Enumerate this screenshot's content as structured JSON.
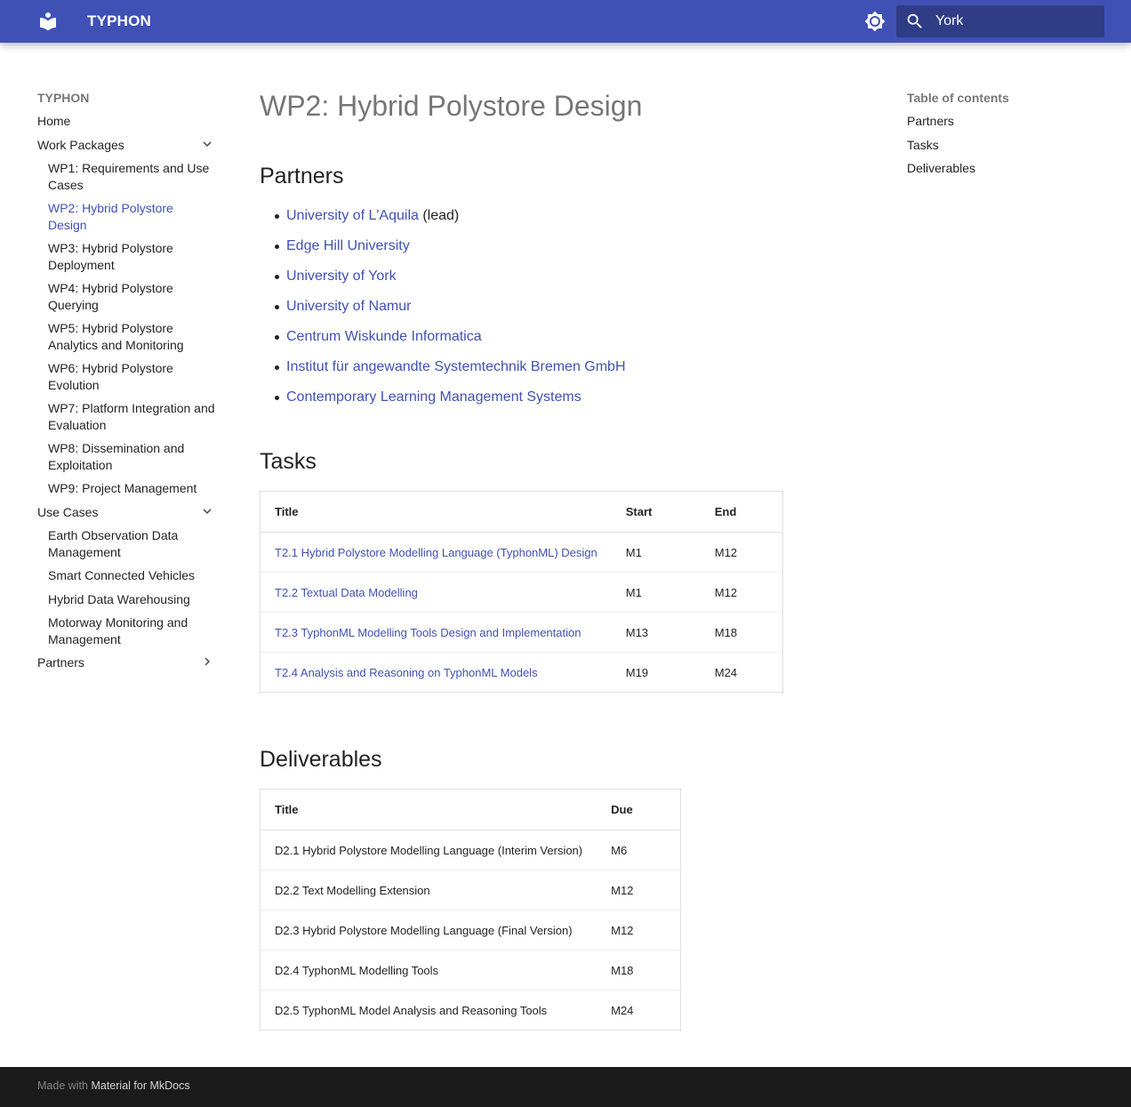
{
  "header": {
    "site_title": "TYPHON",
    "logo_icon": "book-open-icon",
    "palette_icon": "brightness-icon",
    "search": {
      "value": "York",
      "placeholder": "Search"
    },
    "colors": {
      "primary": "#4051b5"
    }
  },
  "sidebar": {
    "title": "TYPHON",
    "home": "Home",
    "work_packages": {
      "label": "Work Packages",
      "items": [
        "WP1: Requirements and Use Cases",
        "WP2: Hybrid Polystore Design",
        "WP3: Hybrid Polystore Deployment",
        "WP4: Hybrid Polystore Querying",
        "WP5: Hybrid Polystore Analytics and Monitoring",
        "WP6: Hybrid Polystore Evolution",
        "WP7: Platform Integration and Evaluation",
        "WP8: Dissemination and Exploitation",
        "WP9: Project Management"
      ]
    },
    "use_cases": {
      "label": "Use Cases",
      "items": [
        "Earth Observation Data Management",
        "Smart Connected Vehicles",
        "Hybrid Data Warehousing",
        "Motorway Monitoring and Management"
      ]
    },
    "partners": "Partners"
  },
  "toc": {
    "title": "Table of contents",
    "items": [
      "Partners",
      "Tasks",
      "Deliverables"
    ]
  },
  "main": {
    "title": "WP2: Hybrid Polystore Design",
    "partners_heading": "Partners",
    "partners": [
      {
        "name": "University of L'Aquila",
        "suffix": " (lead)"
      },
      {
        "name": "Edge Hill University",
        "suffix": ""
      },
      {
        "name": "University of York",
        "suffix": ""
      },
      {
        "name": "University of Namur",
        "suffix": ""
      },
      {
        "name": "Centrum Wiskunde Informatica",
        "suffix": ""
      },
      {
        "name": "Institut für angewandte Systemtechnik Bremen GmbH",
        "suffix": ""
      },
      {
        "name": "Contemporary Learning Management Systems",
        "suffix": ""
      }
    ],
    "tasks_heading": "Tasks",
    "tasks_table": {
      "headers": [
        "Title",
        "Start",
        "End"
      ],
      "rows": [
        [
          "T2.1 Hybrid Polystore Modelling Language (TyphonML) Design",
          "M1",
          "M12"
        ],
        [
          "T2.2 Textual Data Modelling",
          "M1",
          "M12"
        ],
        [
          "T2.3 TyphonML Modelling Tools Design and Implementation",
          "M13",
          "M18"
        ],
        [
          "T2.4 Analysis and Reasoning on TyphonML Models",
          "M19",
          "M24"
        ]
      ]
    },
    "deliverables_heading": "Deliverables",
    "deliverables_table": {
      "headers": [
        "Title",
        "Due"
      ],
      "rows": [
        [
          "D2.1 Hybrid Polystore Modelling Language (Interim Version)",
          "M6"
        ],
        [
          "D2.2 Text Modelling Extension",
          "M12"
        ],
        [
          "D2.3 Hybrid Polystore Modelling Language (Final Version)",
          "M12"
        ],
        [
          "D2.4 TyphonML Modelling Tools",
          "M18"
        ],
        [
          "D2.5 TyphonML Model Analysis and Reasoning Tools",
          "M24"
        ]
      ]
    }
  },
  "footer": {
    "made_with": "Made with",
    "link": "Material for MkDocs"
  }
}
